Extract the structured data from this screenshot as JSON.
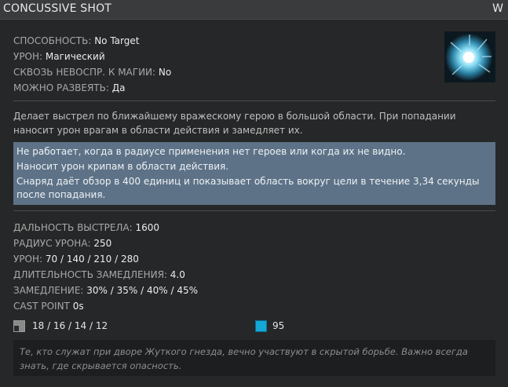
{
  "header": {
    "title": "CONCUSSIVE SHOT",
    "hotkey": "W"
  },
  "properties": [
    {
      "label": "СПОСОБНОСТЬ:",
      "value": "No Target"
    },
    {
      "label": "УРОН:",
      "value": "Магический"
    },
    {
      "label": "СКВОЗЬ НЕВОСПР. К МАГИИ:",
      "value": "No"
    },
    {
      "label": "МОЖНО РАЗВЕЯТЬ:",
      "value": "Да"
    }
  ],
  "ability_icon": "concussive-shot-icon",
  "description": "Делает выстрел по ближайшему вражескому герою в большой области. При попадании наносит урон врагам в области действия и замедляет их.",
  "notes": [
    "Не работает, когда в радиусе применения нет героев или когда их не видно.",
    "Наносит урон крипам в области действия.",
    "Снаряд даёт обзор в 400 единиц и показывает область вокруг цели в течение 3,34 секунды после попадания."
  ],
  "stats": [
    {
      "label": "ДАЛЬНОСТЬ ВЫСТРЕЛА:",
      "value": "1600"
    },
    {
      "label": "РАДИУС УРОНА:",
      "value": "250"
    },
    {
      "label": "УРОН:",
      "value": "70 / 140 / 210 / 280"
    },
    {
      "label": "ДЛИТЕЛЬНОСТЬ ЗАМЕДЛЕНИЯ:",
      "value": "4.0"
    },
    {
      "label": "ЗАМЕДЛЕНИЕ:",
      "value": "30% / 35% / 40% / 45%"
    },
    {
      "label": "CAST POINT",
      "value": "0s"
    }
  ],
  "costs": {
    "cooldown_icon": "cooldown-icon",
    "cooldown": "18 / 16 / 14 / 12",
    "mana_icon": "mana-icon",
    "mana": "95"
  },
  "lore": "Те, кто служат при дворе Жуткого гнезда, вечно участвуют в скрытой борьбе. Важно всегда знать, где скрывается опасность.",
  "colors": {
    "notes_background": "#5e7287",
    "mana": "#15a7d6",
    "panel_background": "#262728"
  }
}
